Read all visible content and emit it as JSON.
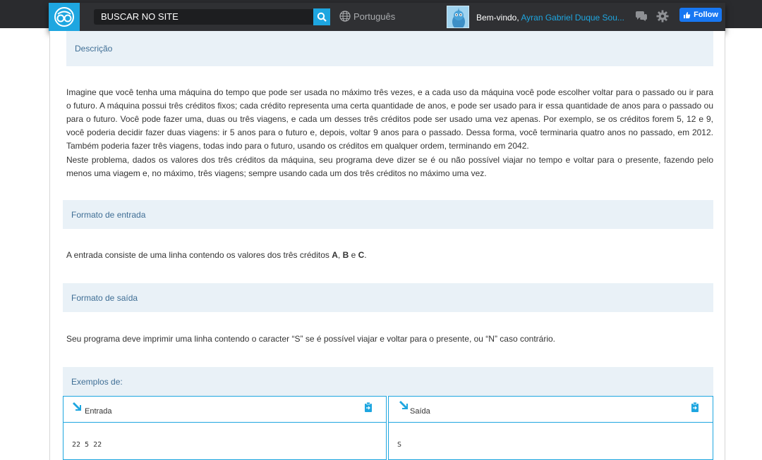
{
  "header": {
    "search_placeholder": "BUSCAR NO SITE",
    "language": "Português",
    "welcome_prefix": "Bem-vindo,",
    "user_name": "Ayran Gabriel Duque Sou...",
    "follow_label": "Follow"
  },
  "sections": {
    "description": {
      "title": "Descrição",
      "p1": "Imagine que você tenha uma máquina do tempo que pode ser usada no máximo três vezes, e a cada uso da máquina você pode escolher voltar para o passado ou ir para o futuro. A máquina possui três créditos fixos; cada crédito representa uma certa quantidade de anos, e pode ser usado para ir essa quantidade de anos para o passado ou para o futuro. Você pode fazer uma, duas ou três viagens, e cada um desses três créditos pode ser usado uma vez apenas. Por exemplo, se os créditos forem 5, 12 e 9, você poderia decidir fazer duas viagens: ir 5 anos para o futuro e, depois, voltar 9 anos para o passado. Dessa forma, você terminaria quatro anos no passado, em 2012. Também poderia fazer três viagens, todas indo para o futuro, usando os créditos em qualquer ordem, terminando em 2042.",
      "p2": "Neste problema, dados os valores dos três créditos da máquina, seu programa deve dizer se é ou não possível viajar no tempo e voltar para o presente, fazendo pelo menos uma viagem e, no máximo, três viagens; sempre usando cada um dos três créditos no máximo uma vez."
    },
    "input_format": {
      "title": "Formato de entrada",
      "text_prefix": "A entrada consiste de uma linha contendo os valores dos três créditos ",
      "var_a": "A",
      "sep1": ", ",
      "var_b": "B",
      "sep2": " e ",
      "var_c": "C",
      "text_suffix": "."
    },
    "output_format": {
      "title": "Formato de saída",
      "text": "Seu programa deve imprimir uma linha contendo o caracter “S” se é possível viajar e voltar para o presente, ou “N” caso contrário."
    },
    "examples": {
      "title": "Exemplos de:",
      "input_label": "Entrada",
      "output_label": "Saída",
      "input_value": "22 5 22",
      "output_value": "S"
    }
  },
  "colors": {
    "accent": "#1ea6e0",
    "section_bg": "#e9f1f7",
    "section_text": "#3f6e95",
    "topbar": "#2f3033"
  },
  "icons": [
    "logo-icon",
    "search-icon",
    "globe-icon",
    "chat-icon",
    "gear-icon",
    "thumbs-up-icon",
    "input-arrow-icon",
    "output-arrow-icon",
    "copy-icon"
  ]
}
